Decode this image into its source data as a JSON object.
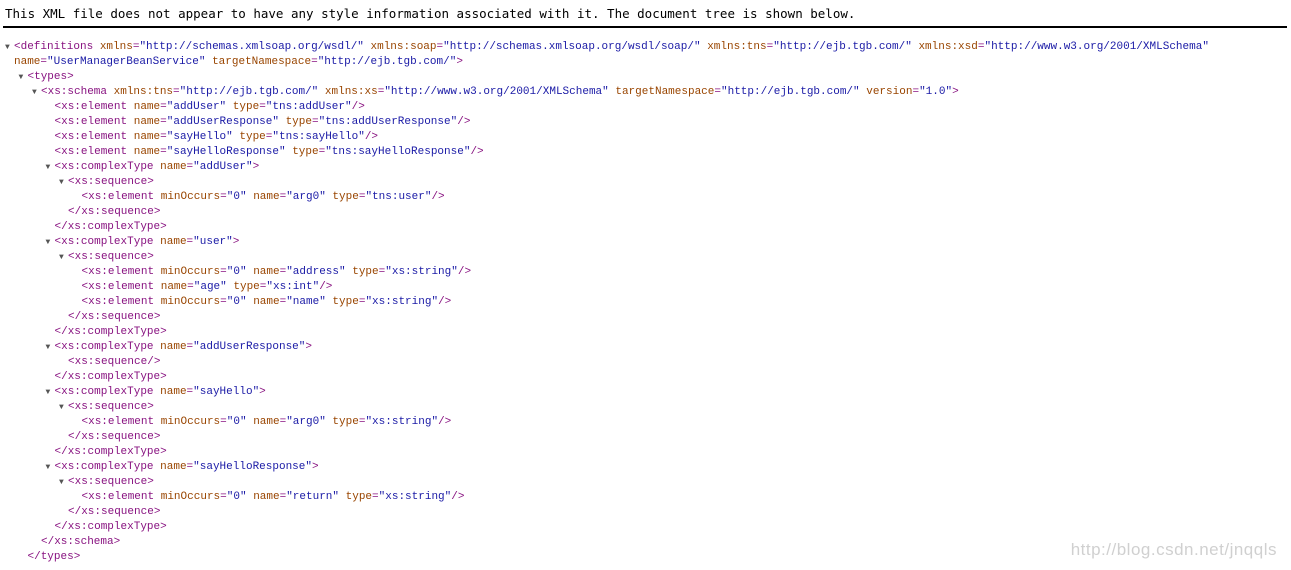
{
  "banner": "This XML file does not appear to have any style information associated with it. The document tree is shown below.",
  "watermark": "http://blog.csdn.net/jnqqls",
  "lines": [
    {
      "lvl": 0,
      "arrow": true,
      "text": "<definitions xmlns=\"http://schemas.xmlsoap.org/wsdl/\" xmlns:soap=\"http://schemas.xmlsoap.org/wsdl/soap/\" xmlns:tns=\"http://ejb.tgb.com/\" xmlns:xsd=\"http://www.w3.org/2001/XMLSchema\""
    },
    {
      "lvl": 0,
      "arrow": false,
      "text": "name=\"UserManagerBeanService\" targetNamespace=\"http://ejb.tgb.com/\">"
    },
    {
      "lvl": 1,
      "arrow": true,
      "text": "<types>"
    },
    {
      "lvl": 2,
      "arrow": true,
      "text": "<xs:schema xmlns:tns=\"http://ejb.tgb.com/\" xmlns:xs=\"http://www.w3.org/2001/XMLSchema\" targetNamespace=\"http://ejb.tgb.com/\" version=\"1.0\">"
    },
    {
      "lvl": 3,
      "arrow": false,
      "text": "<xs:element name=\"addUser\" type=\"tns:addUser\"/>"
    },
    {
      "lvl": 3,
      "arrow": false,
      "text": "<xs:element name=\"addUserResponse\" type=\"tns:addUserResponse\"/>"
    },
    {
      "lvl": 3,
      "arrow": false,
      "text": "<xs:element name=\"sayHello\" type=\"tns:sayHello\"/>"
    },
    {
      "lvl": 3,
      "arrow": false,
      "text": "<xs:element name=\"sayHelloResponse\" type=\"tns:sayHelloResponse\"/>"
    },
    {
      "lvl": 3,
      "arrow": true,
      "text": "<xs:complexType name=\"addUser\">"
    },
    {
      "lvl": 4,
      "arrow": true,
      "text": "<xs:sequence>"
    },
    {
      "lvl": 5,
      "arrow": false,
      "text": "<xs:element minOccurs=\"0\" name=\"arg0\" type=\"tns:user\"/>"
    },
    {
      "lvl": 4,
      "arrow": false,
      "text": "</xs:sequence>"
    },
    {
      "lvl": 3,
      "arrow": false,
      "text": "</xs:complexType>"
    },
    {
      "lvl": 3,
      "arrow": true,
      "text": "<xs:complexType name=\"user\">"
    },
    {
      "lvl": 4,
      "arrow": true,
      "text": "<xs:sequence>"
    },
    {
      "lvl": 5,
      "arrow": false,
      "text": "<xs:element minOccurs=\"0\" name=\"address\" type=\"xs:string\"/>"
    },
    {
      "lvl": 5,
      "arrow": false,
      "text": "<xs:element name=\"age\" type=\"xs:int\"/>"
    },
    {
      "lvl": 5,
      "arrow": false,
      "text": "<xs:element minOccurs=\"0\" name=\"name\" type=\"xs:string\"/>"
    },
    {
      "lvl": 4,
      "arrow": false,
      "text": "</xs:sequence>"
    },
    {
      "lvl": 3,
      "arrow": false,
      "text": "</xs:complexType>"
    },
    {
      "lvl": 3,
      "arrow": true,
      "text": "<xs:complexType name=\"addUserResponse\">"
    },
    {
      "lvl": 4,
      "arrow": false,
      "text": "<xs:sequence/>"
    },
    {
      "lvl": 3,
      "arrow": false,
      "text": "</xs:complexType>"
    },
    {
      "lvl": 3,
      "arrow": true,
      "text": "<xs:complexType name=\"sayHello\">"
    },
    {
      "lvl": 4,
      "arrow": true,
      "text": "<xs:sequence>"
    },
    {
      "lvl": 5,
      "arrow": false,
      "text": "<xs:element minOccurs=\"0\" name=\"arg0\" type=\"xs:string\"/>"
    },
    {
      "lvl": 4,
      "arrow": false,
      "text": "</xs:sequence>"
    },
    {
      "lvl": 3,
      "arrow": false,
      "text": "</xs:complexType>"
    },
    {
      "lvl": 3,
      "arrow": true,
      "text": "<xs:complexType name=\"sayHelloResponse\">"
    },
    {
      "lvl": 4,
      "arrow": true,
      "text": "<xs:sequence>"
    },
    {
      "lvl": 5,
      "arrow": false,
      "text": "<xs:element minOccurs=\"0\" name=\"return\" type=\"xs:string\"/>"
    },
    {
      "lvl": 4,
      "arrow": false,
      "text": "</xs:sequence>"
    },
    {
      "lvl": 3,
      "arrow": false,
      "text": "</xs:complexType>"
    },
    {
      "lvl": 2,
      "arrow": false,
      "text": "</xs:schema>"
    },
    {
      "lvl": 1,
      "arrow": false,
      "text": "</types>"
    }
  ]
}
